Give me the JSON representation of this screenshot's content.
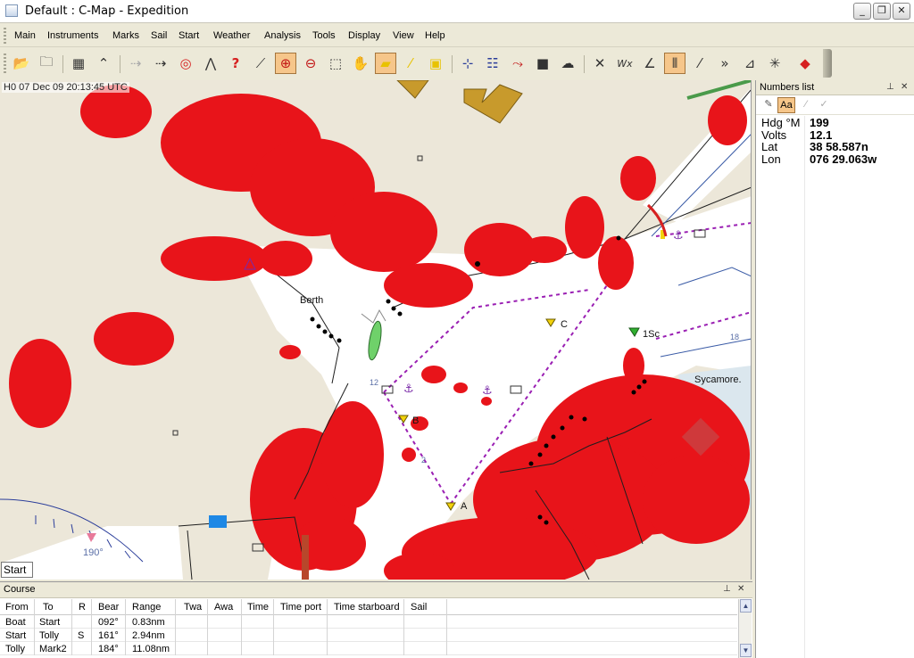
{
  "window": {
    "title": "Default : C-Map - Expedition"
  },
  "menu": [
    "Main",
    "Instruments",
    "Marks",
    "Sail",
    "Start",
    "Weather",
    "Analysis",
    "Tools",
    "Display",
    "View",
    "Help"
  ],
  "map": {
    "timestamp": "H0 07 Dec 09 20:13:45 UTC",
    "labels": {
      "berth": "Berth",
      "sycamore": "Sycamore.",
      "mark_c": "C",
      "mark_b": "B",
      "mark_a": "A",
      "mark_1sc": "1Sc",
      "heading": "190°"
    },
    "depths": [
      "12",
      "2",
      "18"
    ],
    "start_button": "Start"
  },
  "numbers_list": {
    "title": "Numbers list",
    "rows": [
      {
        "name": "Hdg °M",
        "value": "199"
      },
      {
        "name": "Volts",
        "value": "12.1"
      },
      {
        "name": "Lat",
        "value": "38 58.587n"
      },
      {
        "name": "Lon",
        "value": "076 29.063w"
      }
    ]
  },
  "course": {
    "title": "Course",
    "columns": [
      "From",
      "To",
      "R",
      "Bear",
      "Range",
      "Twa",
      "Awa",
      "Time",
      "Time port",
      "Time starboard",
      "Sail"
    ],
    "rows": [
      {
        "from": "Boat",
        "to": "Start",
        "r": "",
        "bear": "092°",
        "range": "0.83nm"
      },
      {
        "from": "Start",
        "to": "Tolly",
        "r": "S",
        "bear": "161°",
        "range": "2.94nm"
      },
      {
        "from": "Tolly",
        "to": "Mark2",
        "r": "",
        "bear": "184°",
        "range": "11.08nm"
      }
    ]
  },
  "colors": {
    "radar": "#e8141a",
    "water": "#ffffff",
    "land": "#ece7d9",
    "route": "#9a1fb3",
    "toolbar_active": "#f6c68a"
  }
}
